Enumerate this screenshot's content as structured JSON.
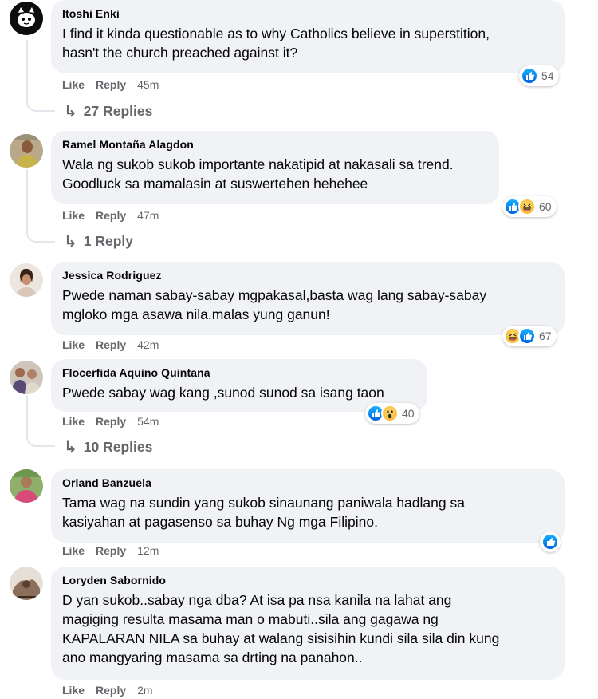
{
  "actions": {
    "like": "Like",
    "reply": "Reply"
  },
  "comments": [
    {
      "name": "Itoshi Enki",
      "text_lines": [
        "I find it kinda questionable as to why Catholics believe in superstition,",
        "hasn't the church preached against it?"
      ],
      "time": "45m",
      "reaction_count": "54",
      "replies": "27 Replies"
    },
    {
      "name": "Ramel Montaña Alagdon",
      "text_lines": [
        "Wala ng sukob sukob importante nakatipid at nakasali sa trend.",
        "Goodluck sa mamalasin at suswertehen hehehee"
      ],
      "time": "47m",
      "reaction_count": "60",
      "replies": "1 Reply"
    },
    {
      "name": "Jessica Rodriguez",
      "text_lines": [
        "Pwede naman sabay-sabay mgpakasal,basta wag lang sabay-sabay",
        "mgloko mga asawa nila.malas yung ganun!"
      ],
      "time": "42m",
      "reaction_count": "67"
    },
    {
      "name": "Flocerfida Aquino Quintana",
      "text_lines": [
        "Pwede sabay wag kang ,sunod sunod sa isang taon"
      ],
      "time": "54m",
      "reaction_count": "40",
      "replies": "10 Replies"
    },
    {
      "name": "Orland Banzuela",
      "text_lines": [
        "Tama wag na sundin yang sukob sinaunang paniwala hadlang sa",
        "kasiyahan at pagasenso sa buhay Ng mga Filipino."
      ],
      "time": "12m"
    },
    {
      "name": "Loryden Sabornido",
      "text_lines": [
        "D yan sukob..sabay nga dba? At isa pa nsa kanila na lahat ang",
        "magiging resulta masama man o mabuti..sila ang gagawa ng",
        "KAPALARAN NILA sa buhay at walang sisisihin kundi sila sila din kung",
        "ano mangyaring masama sa drting na panahon.."
      ],
      "time": "2m"
    }
  ]
}
